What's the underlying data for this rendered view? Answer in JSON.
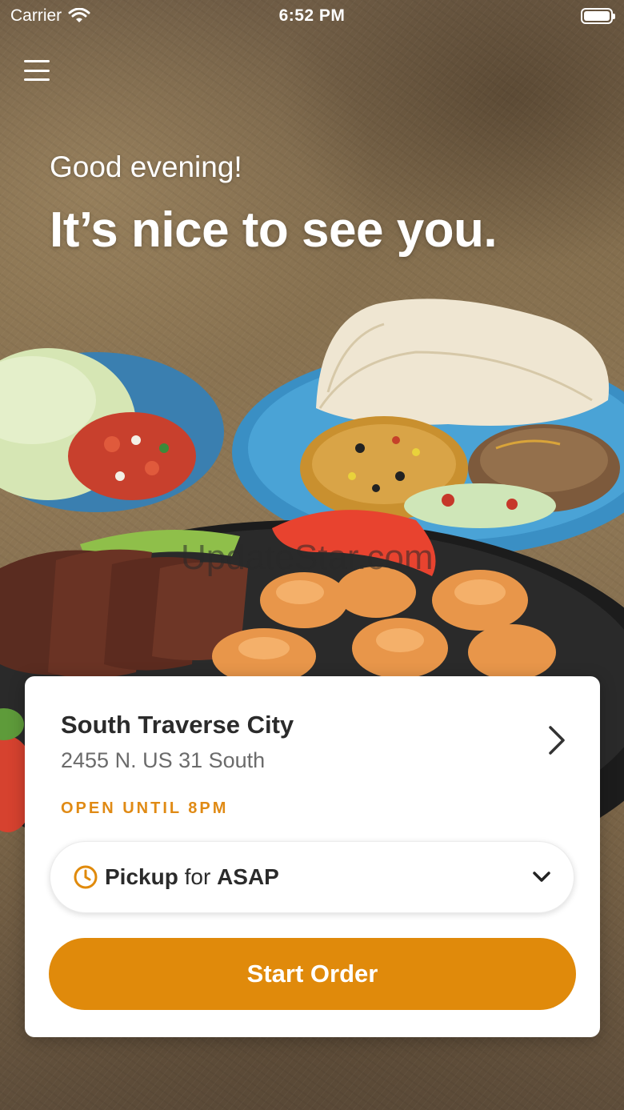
{
  "status_bar": {
    "carrier": "Carrier",
    "time": "6:52 PM"
  },
  "icons": {
    "wifi": "wifi-icon",
    "battery": "battery-icon",
    "menu": "hamburger-menu-icon",
    "chevron_right": "chevron-right-icon",
    "clock": "clock-icon",
    "chevron_down": "chevron-down-icon"
  },
  "hero": {
    "greeting": "Good evening!",
    "headline": "It’s nice to see you."
  },
  "watermark": "UpdateStar.com",
  "location_card": {
    "name": "South Traverse City",
    "address": "2455 N. US 31 South",
    "hours_status": "OPEN UNTIL 8PM",
    "pickup": {
      "mode": "Pickup",
      "connector": "for",
      "time": "ASAP"
    },
    "start_order_label": "Start Order"
  },
  "colors": {
    "accent": "#e08a0b",
    "status_text": "#e08a14",
    "card_bg": "#ffffff",
    "title_text": "#2b2b2b",
    "secondary_text": "#6b6b6b"
  }
}
